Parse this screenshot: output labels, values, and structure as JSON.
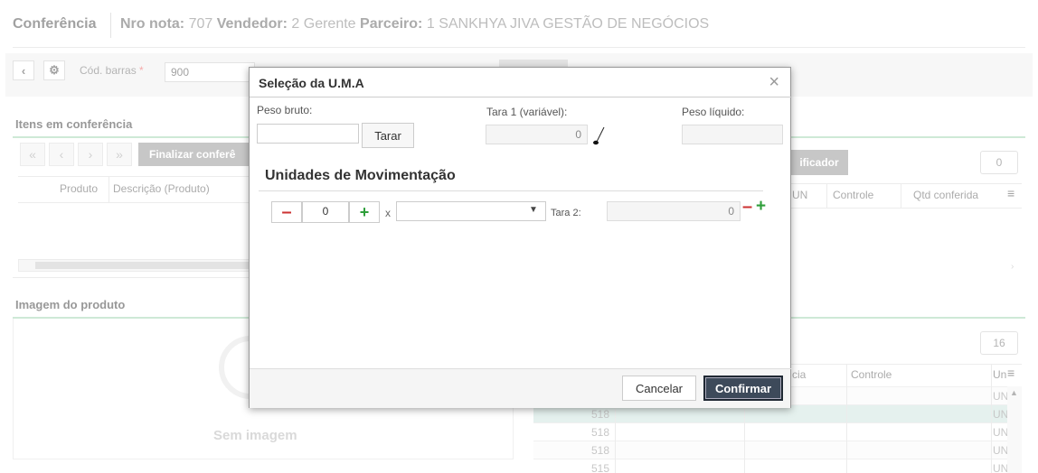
{
  "header": {
    "title": "Conferência",
    "nro_label": "Nro nota:",
    "nro_value": "707",
    "vendedor_label": "Vendedor:",
    "vendedor_value": "2 Gerente",
    "parceiro_label": "Parceiro:",
    "parceiro_value": "1 SANKHYA JIVA GESTÃO DE NEGÓCIOS"
  },
  "toolbar": {
    "barcode_label": "Cód. barras",
    "required_mark": "*",
    "barcode_value": "900",
    "back_icon": "chevron-left-icon",
    "settings_icon": "gear-icon"
  },
  "items_panel": {
    "title": "Itens em conferência",
    "finalize_button": "Finalizar conferê",
    "columns": [
      "Produto",
      "Descrição (Produto)"
    ]
  },
  "right_top_panel": {
    "button": "ificador",
    "badge": "0",
    "columns": [
      "UN",
      "Controle",
      "Qtd conferida"
    ]
  },
  "image_panel": {
    "title": "Imagem do produto",
    "placeholder": "Sem imagem"
  },
  "right_bottom_panel": {
    "badge": "16",
    "columns": [
      "cia",
      "Controle",
      "Un"
    ],
    "rows": [
      {
        "num": "",
        "un": "UN"
      },
      {
        "num": "518",
        "un": "UN"
      },
      {
        "num": "518",
        "un": "UN"
      },
      {
        "num": "518",
        "un": "UN"
      },
      {
        "num": "515",
        "un": "UN"
      }
    ]
  },
  "modal": {
    "title": "Seleção da U.M.A",
    "close": "×",
    "peso_bruto_label": "Peso bruto:",
    "peso_bruto_value": "",
    "tarar_button": "Tarar",
    "tara1_label": "Tara 1 (variável):",
    "tara1_value": "0",
    "peso_liquido_label": "Peso líquido:",
    "peso_liquido_value": "",
    "section_title": "Unidades de Movimentação",
    "qty_value": "0",
    "times": "x",
    "unit_select_value": "",
    "tara2_label": "Tara 2:",
    "tara2_value": "0",
    "cancel_button": "Cancelar",
    "confirm_button": "Confirmar",
    "colors": {
      "minus": "#cc3333",
      "plus": "#2e9e3a",
      "confirm_bg": "#3d4a5a"
    }
  }
}
